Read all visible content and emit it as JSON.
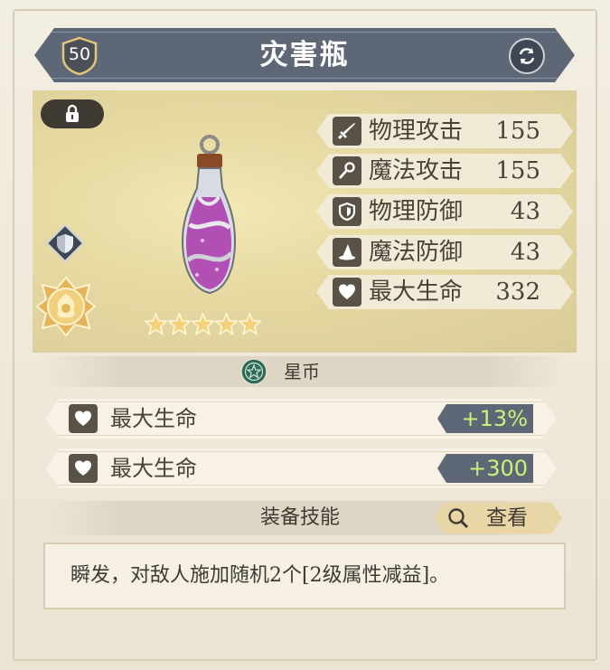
{
  "item": {
    "name": "灾害瓶",
    "level": "50",
    "star_count": 5,
    "max_stars": 5
  },
  "stats": [
    {
      "name": "物理攻击",
      "value": "155",
      "icon": "sword-icon"
    },
    {
      "name": "魔法攻击",
      "value": "155",
      "icon": "staff-icon"
    },
    {
      "name": "物理防御",
      "value": "43",
      "icon": "shield-icon"
    },
    {
      "name": "魔法防御",
      "value": "43",
      "icon": "wizard-hat-icon"
    },
    {
      "name": "最大生命",
      "value": "332",
      "icon": "heart-icon"
    }
  ],
  "currency": {
    "label": "星币",
    "icon": "star-coin-icon"
  },
  "bonuses": [
    {
      "name": "最大生命",
      "value": "+13%",
      "icon": "heart-icon"
    },
    {
      "name": "最大生命",
      "value": "+300",
      "icon": "heart-icon"
    }
  ],
  "skill": {
    "header": "装备技能",
    "view_button": "查看",
    "description": "瞬发，对敌人施加随机2个[2级属性减益]。"
  },
  "colors": {
    "banner": "#5d6776",
    "bonus_value_text": "#c8f27a",
    "icon_bg": "#5b5247",
    "star": "#f4d27a"
  }
}
